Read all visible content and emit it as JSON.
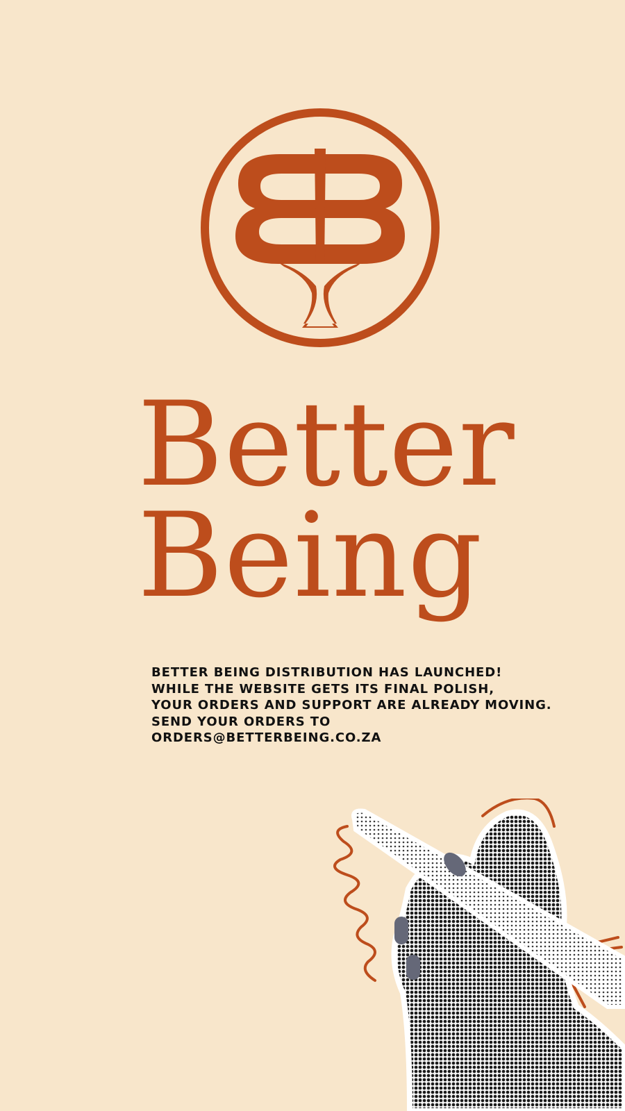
{
  "brand": {
    "logo_icon": "bb-monogram-tree-icon",
    "name_lines": [
      "Better",
      "Being"
    ],
    "color": "#bd4d1c"
  },
  "announcement": {
    "lines": [
      "BETTER BEING DISTRIBUTION HAS LAUNCHED!",
      "WHILE THE WEBSITE GETS ITS FINAL POLISH,",
      "YOUR ORDERS AND SUPPORT ARE ALREADY MOVING.",
      "SEND YOUR ORDERS TO",
      "ORDERS@BETTERBEING.CO.ZA"
    ],
    "color": "#111111"
  },
  "illustration": {
    "icon": "hand-holding-marker-icon"
  },
  "colors": {
    "background": "#f8e6cb",
    "accent": "#bd4d1c"
  }
}
